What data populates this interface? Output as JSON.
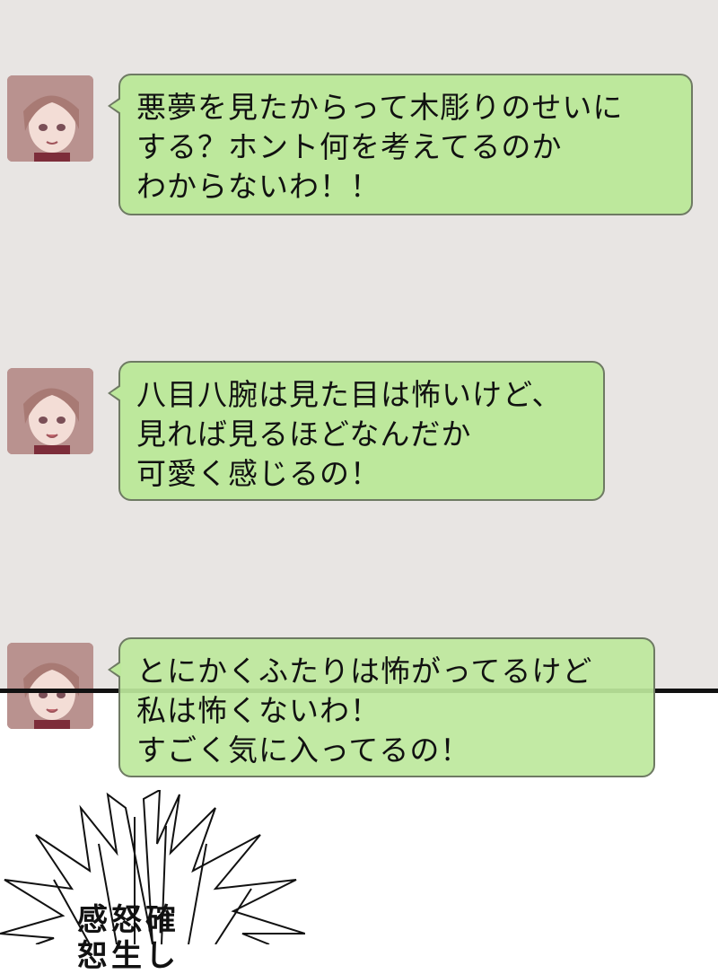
{
  "messages": [
    {
      "lines": [
        "悪夢を見たからって木彫りのせいに",
        "する？ホント何を考えてるのか",
        "わからないわ！！"
      ]
    },
    {
      "lines": [
        "八目八腕は見た目は怖いけど、",
        "見れば見るほどなんだか",
        "可愛く感じるの！"
      ]
    },
    {
      "lines": [
        "とにかくふたりは怖がってるけど",
        "私は怖くないわ！",
        "すごく気に入ってるの！"
      ]
    }
  ],
  "sfx": {
    "line1": "感怒確",
    "line2": "恕生し"
  },
  "colors": {
    "chat_bg": "#e8e5e3",
    "bubble": "#bde89c",
    "bubble_border": "#6e7a63",
    "avatar_hair": "#c9a3a0"
  },
  "icons": {
    "avatar": "avatar-icon",
    "burst": "impact-burst"
  }
}
